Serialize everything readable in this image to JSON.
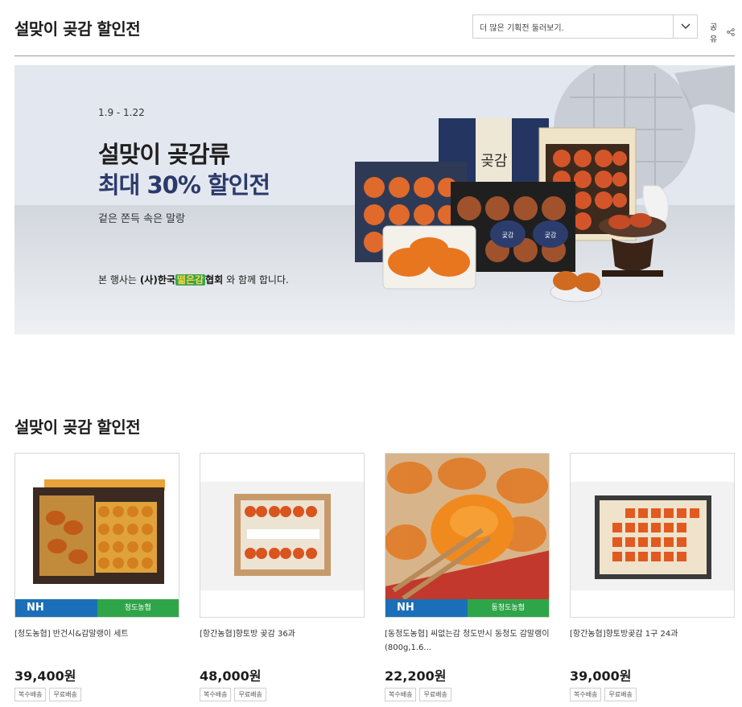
{
  "header": {
    "title": "설맞이 곶감 할인전",
    "select_value": "더 많은 기획전 둘러보기.",
    "share_label": "공유"
  },
  "banner": {
    "date": "1.9 - 1.22",
    "headline1": "설맞이 곶감류",
    "headline2": "최대 30% 할인전",
    "subline": "겉은 쫀득 속은 말랑",
    "note_prefix": "본 행사는",
    "note_org_a": "(사)한국",
    "note_org_b": "떫은감",
    "note_org_c": "협회",
    "note_suffix": "와 함께 합니다."
  },
  "section": {
    "title": "설맞이 곶감 할인전"
  },
  "products": [
    {
      "name": "[청도농협] 반건시&감말랭이 세트",
      "price": "39,400원",
      "badges": [
        "복수배송",
        "무료배송"
      ],
      "nh_brand": "NH",
      "nh_partner": "청도농협"
    },
    {
      "name": "[항간농협]향토방 곶감 36과",
      "price": "48,000원",
      "badges": [
        "복수배송",
        "무료배송"
      ]
    },
    {
      "name": "[동청도농협] 씨없는감 청도반시 동청도 감말랭이(800g,1.6...",
      "price": "22,200원",
      "badges": [
        "복수배송",
        "무료배송"
      ],
      "nh_brand": "NH",
      "nh_partner": "동청도농협"
    },
    {
      "name": "[항간농협]향토방곶감 1구 24과",
      "price": "39,000원",
      "badges": [
        "복수배송",
        "무료배송"
      ]
    }
  ],
  "colors": {
    "accent_navy": "#2b3a6b",
    "nh_blue": "#1a6fb8",
    "nh_green": "#2fa54a"
  }
}
